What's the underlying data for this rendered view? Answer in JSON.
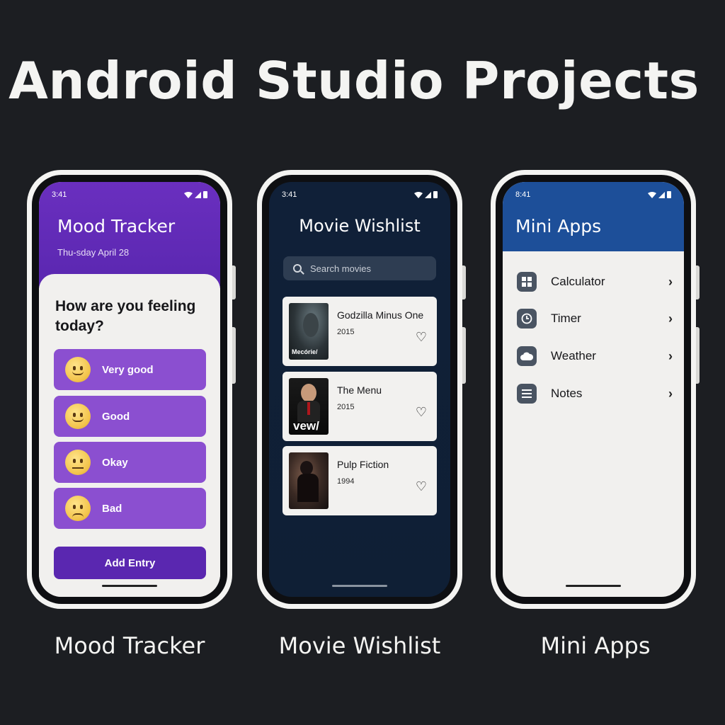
{
  "page": {
    "title": "Android Studio Projects"
  },
  "captions": [
    "Mood Tracker",
    "Movie Wishlist",
    "Mini Apps"
  ],
  "mood": {
    "time": "3:41",
    "title": "Mood Tracker",
    "date": "Thu-sday April 28",
    "question": "How are you feeling today?",
    "options": [
      {
        "label": "Very good",
        "icon": "smile-emoji-icon"
      },
      {
        "label": "Good",
        "icon": "smile-emoji-icon"
      },
      {
        "label": "Okay",
        "icon": "neutral-emoji-icon"
      },
      {
        "label": "Bad",
        "icon": "sad-emoji-icon"
      }
    ],
    "add_label": "Add Entry",
    "colors": {
      "header": "#5a27b0",
      "option": "#8b4fd0",
      "background": "#f1f0ee"
    }
  },
  "movie": {
    "time": "3:41",
    "title": "Movie Wishlist",
    "search_placeholder": "Search movies",
    "items": [
      {
        "name": "Godzilla Minus One",
        "year": "2015",
        "poster_text": "Mecórie/"
      },
      {
        "name": "The Menu",
        "year": "2015",
        "poster_text": "vew/"
      },
      {
        "name": "Pulp Fiction",
        "year": "1994",
        "poster_text": ""
      }
    ],
    "colors": {
      "background": "#102038",
      "card": "#f2f1ef"
    }
  },
  "mini": {
    "time": "8:41",
    "title": "Mini Apps",
    "items": [
      {
        "label": "Calculator",
        "icon": "grid-icon"
      },
      {
        "label": "Timer",
        "icon": "clock-icon"
      },
      {
        "label": "Weather",
        "icon": "cloud-icon"
      },
      {
        "label": "Notes",
        "icon": "list-icon"
      }
    ],
    "colors": {
      "header": "#1d4f99",
      "background": "#f1f0ee"
    }
  }
}
